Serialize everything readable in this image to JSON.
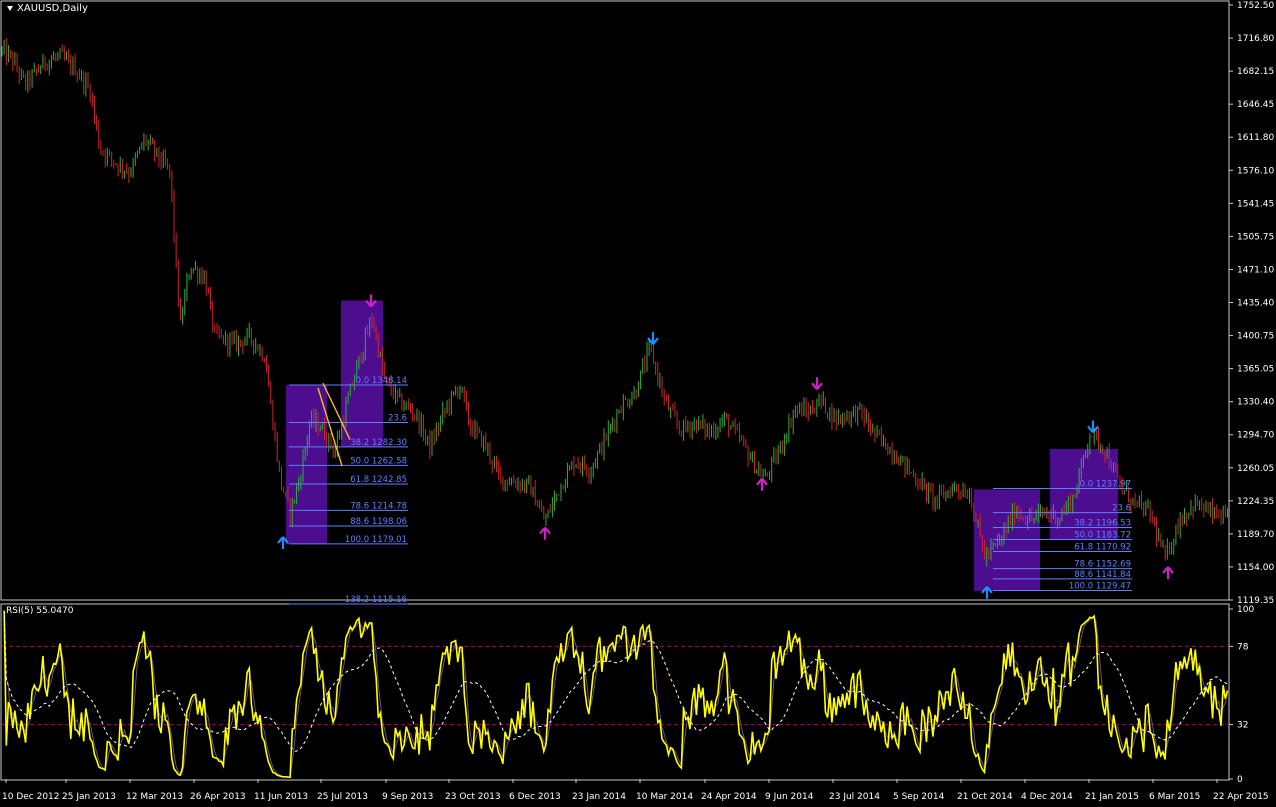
{
  "header": {
    "symbol": "XAUUSD,Daily"
  },
  "rsi_panel": {
    "label": "RSI(5) 55.0470"
  },
  "colors": {
    "background": "#000000",
    "bull": "#2fae3c",
    "bear": "#d0242a",
    "box": "#5b0fa8",
    "fib": "#5f7fff",
    "rsi": "#ffff00",
    "rsi_ma": "#ffffff",
    "rsi_levels": "#b0006f",
    "arrow_blue": "#1e8fff",
    "arrow_magenta": "#d020c8",
    "trendline": "#ffc000"
  },
  "chart_data": [
    {
      "type": "candlestick",
      "title": "XAUUSD,Daily",
      "ylim": [
        1119.35,
        1752.5
      ],
      "y_ticks": [
        "1752.50",
        "1716.80",
        "1682.15",
        "1646.45",
        "1611.80",
        "1576.10",
        "1541.45",
        "1505.75",
        "1471.10",
        "1435.40",
        "1400.75",
        "1365.05",
        "1330.40",
        "1294.70",
        "1260.05",
        "1224.35",
        "1189.70",
        "1154.00",
        "1119.35"
      ],
      "x_ticks": [
        "10 Dec 2012",
        "25 Jan 2013",
        "12 Mar 2013",
        "26 Apr 2013",
        "11 Jun 2013",
        "25 Jul 2013",
        "9 Sep 2013",
        "23 Oct 2013",
        "6 Dec 2013",
        "23 Jan 2014",
        "10 Mar 2014",
        "24 Apr 2014",
        "9 Jun 2014",
        "23 Jul 2014",
        "5 Sep 2014",
        "21 Oct 2014",
        "4 Dec 2014",
        "21 Jan 2015",
        "6 Mar 2015",
        "22 Apr 2015"
      ],
      "price_path": [
        [
          0,
          1705
        ],
        [
          12,
          1695
        ],
        [
          25,
          1668
        ],
        [
          45,
          1692
        ],
        [
          60,
          1698
        ],
        [
          75,
          1685
        ],
        [
          90,
          1662
        ],
        [
          100,
          1600
        ],
        [
          115,
          1585
        ],
        [
          130,
          1575
        ],
        [
          145,
          1610
        ],
        [
          160,
          1588
        ],
        [
          170,
          1575
        ],
        [
          180,
          1410
        ],
        [
          190,
          1475
        ],
        [
          205,
          1462
        ],
        [
          215,
          1400
        ],
        [
          235,
          1392
        ],
        [
          250,
          1400
        ],
        [
          265,
          1378
        ],
        [
          280,
          1248
        ],
        [
          290,
          1212
        ],
        [
          300,
          1250
        ],
        [
          310,
          1310
        ],
        [
          320,
          1305
        ],
        [
          335,
          1278
        ],
        [
          350,
          1340
        ],
        [
          360,
          1378
        ],
        [
          372,
          1420
        ],
        [
          385,
          1352
        ],
        [
          400,
          1330
        ],
        [
          415,
          1318
        ],
        [
          430,
          1282
        ],
        [
          445,
          1322
        ],
        [
          460,
          1348
        ],
        [
          470,
          1305
        ],
        [
          485,
          1285
        ],
        [
          500,
          1248
        ],
        [
          515,
          1245
        ],
        [
          530,
          1240
        ],
        [
          545,
          1203
        ],
        [
          560,
          1240
        ],
        [
          575,
          1268
        ],
        [
          590,
          1258
        ],
        [
          605,
          1290
        ],
        [
          620,
          1325
        ],
        [
          635,
          1340
        ],
        [
          650,
          1388
        ],
        [
          665,
          1330
        ],
        [
          680,
          1300
        ],
        [
          695,
          1308
        ],
        [
          710,
          1298
        ],
        [
          725,
          1312
        ],
        [
          740,
          1290
        ],
        [
          755,
          1262
        ],
        [
          765,
          1248
        ],
        [
          780,
          1280
        ],
        [
          795,
          1322
        ],
        [
          810,
          1320
        ],
        [
          820,
          1332
        ],
        [
          835,
          1312
        ],
        [
          860,
          1320
        ],
        [
          875,
          1295
        ],
        [
          895,
          1275
        ],
        [
          915,
          1250
        ],
        [
          935,
          1225
        ],
        [
          955,
          1240
        ],
        [
          970,
          1232
        ],
        [
          985,
          1165
        ],
        [
          1000,
          1182
        ],
        [
          1015,
          1215
        ],
        [
          1030,
          1205
        ],
        [
          1045,
          1212
        ],
        [
          1060,
          1208
        ],
        [
          1075,
          1232
        ],
        [
          1090,
          1298
        ],
        [
          1105,
          1280
        ],
        [
          1120,
          1240
        ],
        [
          1135,
          1222
        ],
        [
          1150,
          1212
        ],
        [
          1165,
          1163
        ],
        [
          1180,
          1205
        ],
        [
          1195,
          1222
        ],
        [
          1210,
          1212
        ],
        [
          1228,
          1205
        ]
      ],
      "fibonacci_sets": [
        {
          "levels": [
            {
              "ratio": "0.0",
              "price": "1348.14"
            },
            {
              "ratio": "23.6",
              "price": ""
            },
            {
              "ratio": "38.2",
              "price": "1282.30"
            },
            {
              "ratio": "50.0",
              "price": "1262.58"
            },
            {
              "ratio": "61.8",
              "price": "1242.85"
            },
            {
              "ratio": "78.6",
              "price": "1214.78"
            },
            {
              "ratio": "88.6",
              "price": "1198.06"
            },
            {
              "ratio": "100.0",
              "price": "1179.01"
            },
            {
              "ratio": "138.2",
              "price": "1115.16"
            }
          ]
        },
        {
          "levels": [
            {
              "ratio": "0.0",
              "price": "1237.97"
            },
            {
              "ratio": "23.6",
              "price": ""
            },
            {
              "ratio": "38.2",
              "price": "1196.53"
            },
            {
              "ratio": "50.0",
              "price": "1183.72"
            },
            {
              "ratio": "61.8",
              "price": "1170.92"
            },
            {
              "ratio": "78.6",
              "price": "1152.69"
            },
            {
              "ratio": "88.6",
              "price": "1141.84"
            },
            {
              "ratio": "100.0",
              "price": "1129.47"
            }
          ]
        }
      ],
      "signal_arrows": [
        {
          "date_index": 283,
          "price": 1180,
          "direction": "up",
          "color": "blue"
        },
        {
          "date_index": 371,
          "price": 1438,
          "direction": "down",
          "color": "magenta"
        },
        {
          "date_index": 545,
          "price": 1190,
          "direction": "up",
          "color": "magenta"
        },
        {
          "date_index": 653,
          "price": 1398,
          "direction": "down",
          "color": "blue"
        },
        {
          "date_index": 762,
          "price": 1242,
          "direction": "up",
          "color": "magenta"
        },
        {
          "date_index": 817,
          "price": 1350,
          "direction": "down",
          "color": "magenta"
        },
        {
          "date_index": 987,
          "price": 1127,
          "direction": "up",
          "color": "blue"
        },
        {
          "date_index": 1093,
          "price": 1304,
          "direction": "down",
          "color": "blue"
        },
        {
          "date_index": 1168,
          "price": 1148,
          "direction": "up",
          "color": "magenta"
        }
      ]
    },
    {
      "type": "line",
      "title": "RSI(5) 55.0470",
      "ylim": [
        0,
        100
      ],
      "y_ticks": [
        "100",
        "78",
        "32",
        "0"
      ],
      "levels": [
        78,
        32
      ]
    }
  ]
}
